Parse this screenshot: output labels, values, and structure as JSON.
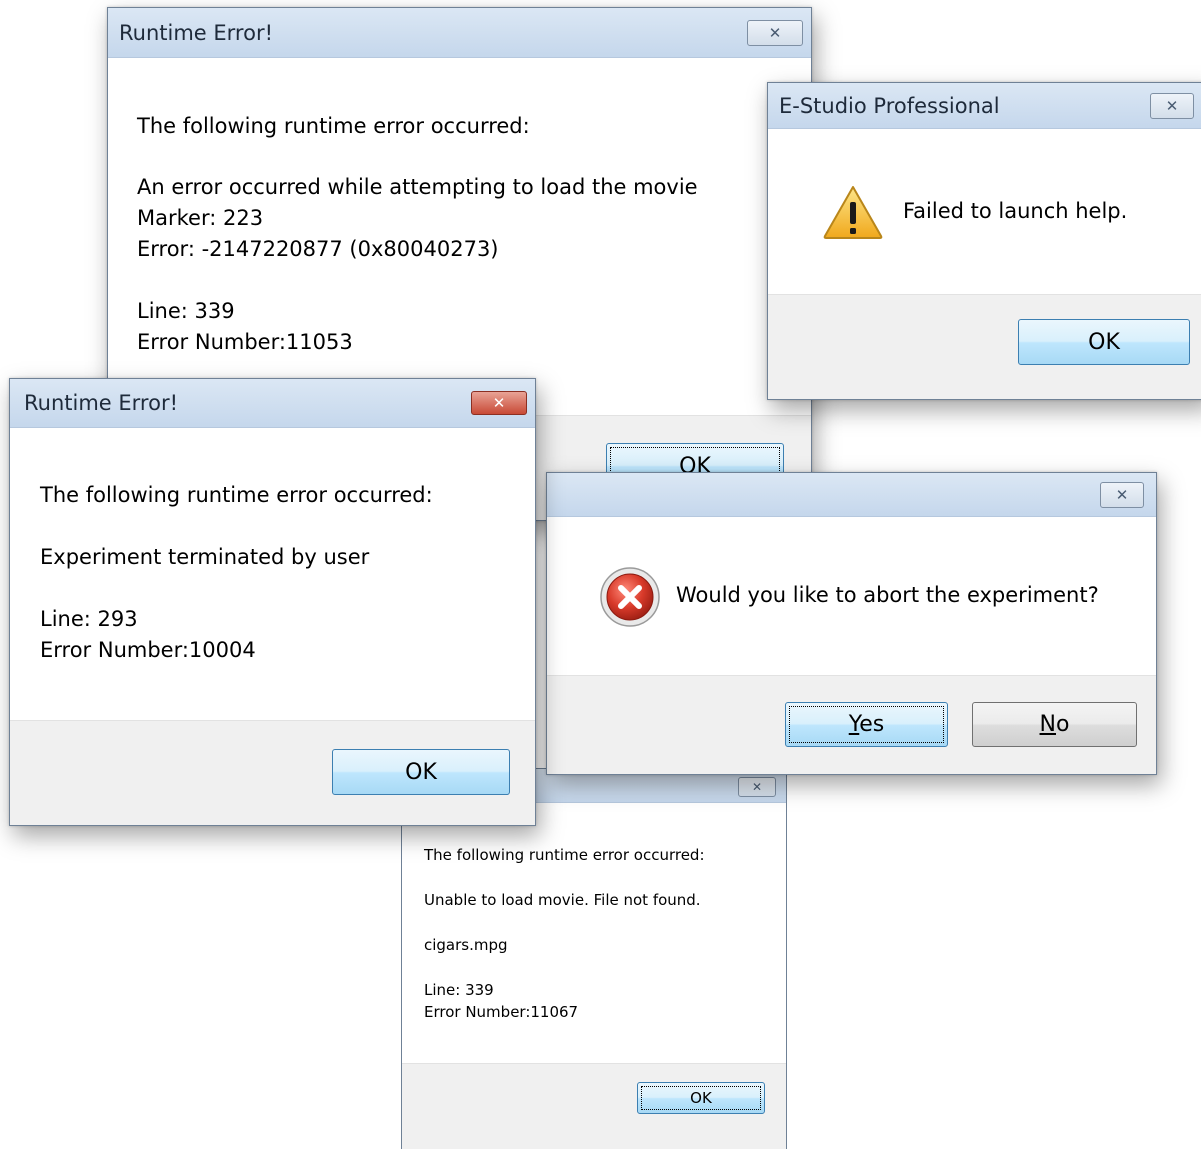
{
  "dialogs": {
    "runtime_error_top": {
      "title": "Runtime Error!",
      "close_glyph": "✕",
      "lines": [
        "The following runtime error occurred:",
        "An error occurred while attempting to load the movie",
        "Marker: 223",
        "Error: -2147220877 (0x80040273)",
        "Line: 339",
        "Error Number:11053"
      ],
      "ok_label": "OK"
    },
    "estudio": {
      "title": "E-Studio Professional",
      "close_glyph": "✕",
      "message": "Failed to launch help.",
      "icon": "warning-icon",
      "ok_label": "OK"
    },
    "runtime_error_left": {
      "title": "Runtime Error!",
      "close_glyph": "✕",
      "lines": [
        "The following runtime error occurred:",
        "Experiment terminated by user",
        "Line: 293",
        "Error Number:10004"
      ],
      "ok_label": "OK"
    },
    "abort": {
      "title": "",
      "close_glyph": "✕",
      "message": "Would you like to abort the experiment?",
      "icon": "error-icon",
      "yes_mnemonic": "Y",
      "yes_rest": "es",
      "no_mnemonic": "N",
      "no_rest": "o"
    },
    "runtime_error_bottom": {
      "title": "",
      "close_glyph": "✕",
      "lines": [
        "The following runtime error occurred:",
        "Unable to load movie.  File not found.",
        "cigars.mpg",
        "Line: 339",
        "Error Number:11067"
      ],
      "ok_label": "OK"
    }
  },
  "colors": {
    "titlebar": "#c5d7ec",
    "footer": "#f0f0f0",
    "default_button": "#bee6fd",
    "close_red": "#c84a36",
    "error_red": "#d83a2a",
    "warning_yellow": "#f5c53a"
  }
}
